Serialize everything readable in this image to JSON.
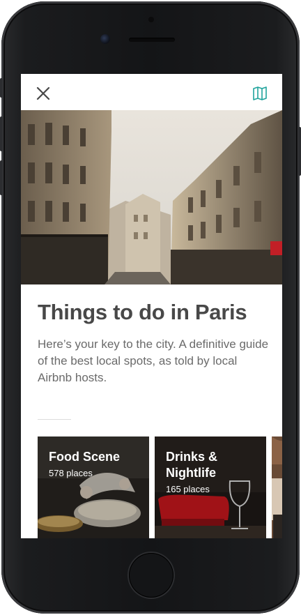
{
  "header": {
    "close_icon": "close-icon",
    "map_icon": "map-icon",
    "accent_color": "#1fa39c"
  },
  "hero": {
    "image": "paris-street-photo"
  },
  "content": {
    "title": "Things to do in Paris",
    "description": "Here’s your key to the city. A definitive guide of the best local spots, as told by local Airbnb hosts."
  },
  "categories": [
    {
      "title": "Food Scene",
      "count": "578 places",
      "image": "crepe-cooking-photo"
    },
    {
      "title": "Drinks & Nightlife",
      "count": "165 places",
      "image": "wine-glass-bar-photo"
    },
    {
      "title": "",
      "count": "",
      "image": "partial-card-photo"
    }
  ]
}
